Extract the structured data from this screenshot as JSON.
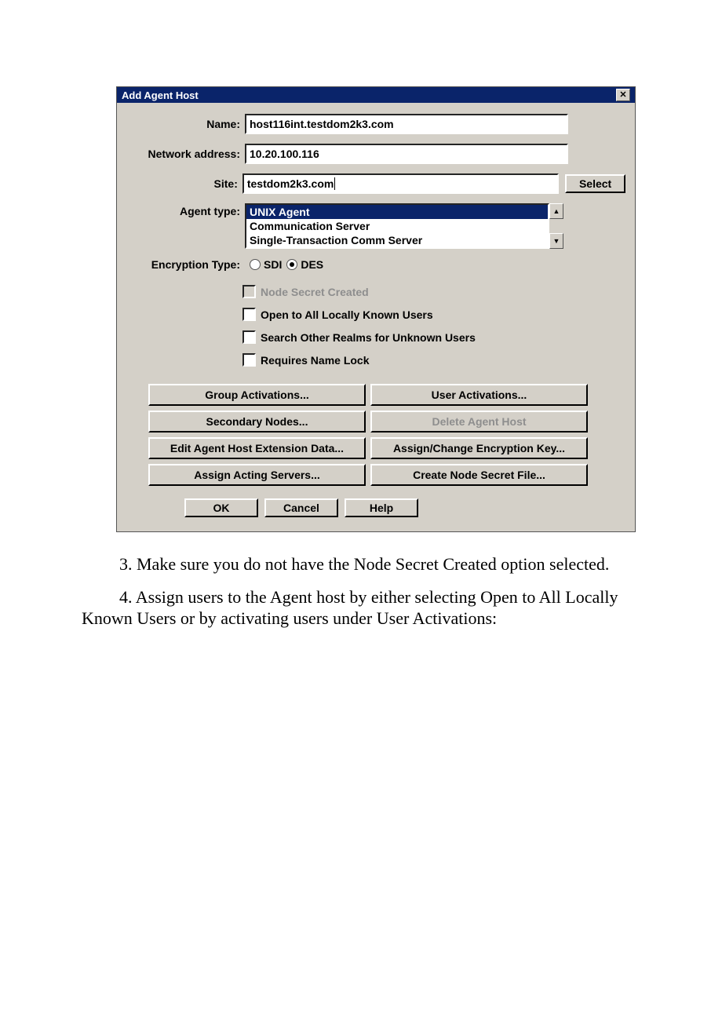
{
  "dialog": {
    "title": "Add Agent Host",
    "labels": {
      "name": "Name:",
      "address": "Network address:",
      "site": "Site:",
      "agent_type": "Agent type:",
      "encryption": "Encryption Type:"
    },
    "fields": {
      "name": "host116int.testdom2k3.com",
      "address": "10.20.100.116",
      "site": "testdom2k3.com"
    },
    "select_button": "Select",
    "agent_type_options": {
      "opt0": "UNIX Agent",
      "opt1": "Communication Server",
      "opt2": "Single-Transaction Comm Server"
    },
    "encryption_options": {
      "sdi": "SDI",
      "des": "DES"
    },
    "checkboxes": {
      "node_secret": "Node Secret Created",
      "open_all": "Open to All Locally Known Users",
      "search_other": "Search Other Realms for Unknown Users",
      "name_lock": "Requires Name Lock"
    },
    "buttons": {
      "group_act": "Group Activations...",
      "user_act": "User Activations...",
      "sec_nodes": "Secondary Nodes...",
      "del_host": "Delete Agent Host",
      "ext_data": "Edit Agent Host Extension Data...",
      "enc_key": "Assign/Change Encryption Key...",
      "acting": "Assign Acting Servers...",
      "create_secret": "Create Node Secret File..."
    },
    "footer": {
      "ok": "OK",
      "cancel": "Cancel",
      "help": "Help"
    }
  },
  "paragraphs": {
    "p3": "3. Make sure you do not have the Node Secret Created option selected.",
    "p4": "4. Assign users to the Agent host by either selecting Open to All Locally Known Users or by activating users under User Activations:"
  }
}
